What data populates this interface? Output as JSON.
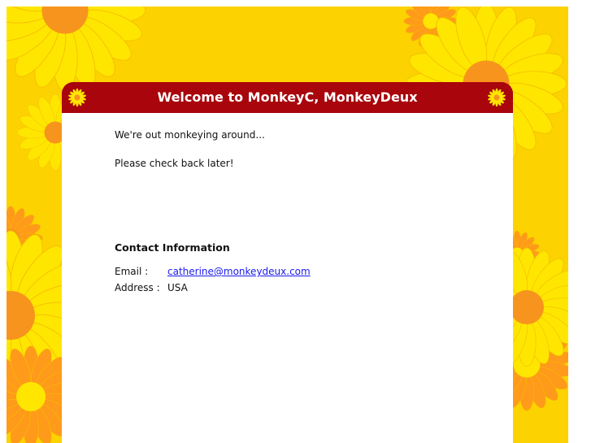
{
  "header": {
    "title": "Welcome to MonkeyC, MonkeyDeux"
  },
  "main": {
    "message_line_1": "We're out monkeying around...",
    "message_line_2": "Please check back later!"
  },
  "contact": {
    "heading": "Contact Information",
    "email_label": "Email :",
    "email_value": "catherine@monkeydeux.com",
    "address_label": "Address :",
    "address_value": "USA"
  },
  "colors": {
    "background": "#fcd200",
    "banner": "#a8050c",
    "petal_yellow": "#ffe600",
    "petal_orange": "#ff9a1a",
    "flower_center": "#f7941d",
    "link": "#1a1aee"
  },
  "icons": {
    "banner_left": "sunflower-icon",
    "banner_right": "sunflower-icon"
  }
}
